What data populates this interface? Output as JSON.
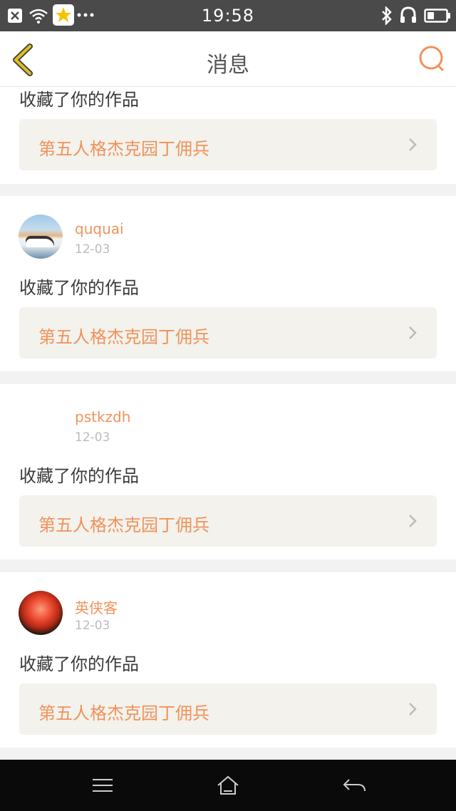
{
  "status_bar": {
    "time": "19:58"
  },
  "header": {
    "title": "消息"
  },
  "feed": {
    "partial_item": {
      "action": "收藏了你的作品",
      "work_title": "第五人格杰克园丁佣兵"
    },
    "items": [
      {
        "username": "ququai",
        "date": "12-03",
        "action": "收藏了你的作品",
        "work_title": "第五人格杰克园丁佣兵",
        "avatar": "car-photo"
      },
      {
        "username": "pstkzdh",
        "date": "12-03",
        "action": "收藏了你的作品",
        "work_title": "第五人格杰克园丁佣兵",
        "avatar": "blank"
      },
      {
        "username": "英侠客",
        "date": "12-03",
        "action": "收藏了你的作品",
        "work_title": "第五人格杰克园丁佣兵",
        "avatar": "rose-photo"
      }
    ]
  },
  "colors": {
    "accent": "#f0925a",
    "back_icon": "#e0c020",
    "link_bg": "#f3f2ed"
  },
  "icons": {
    "back": "chevron-left-icon",
    "search": "search-icon",
    "menu": "menu-icon",
    "home": "home-icon",
    "return": "return-icon"
  }
}
